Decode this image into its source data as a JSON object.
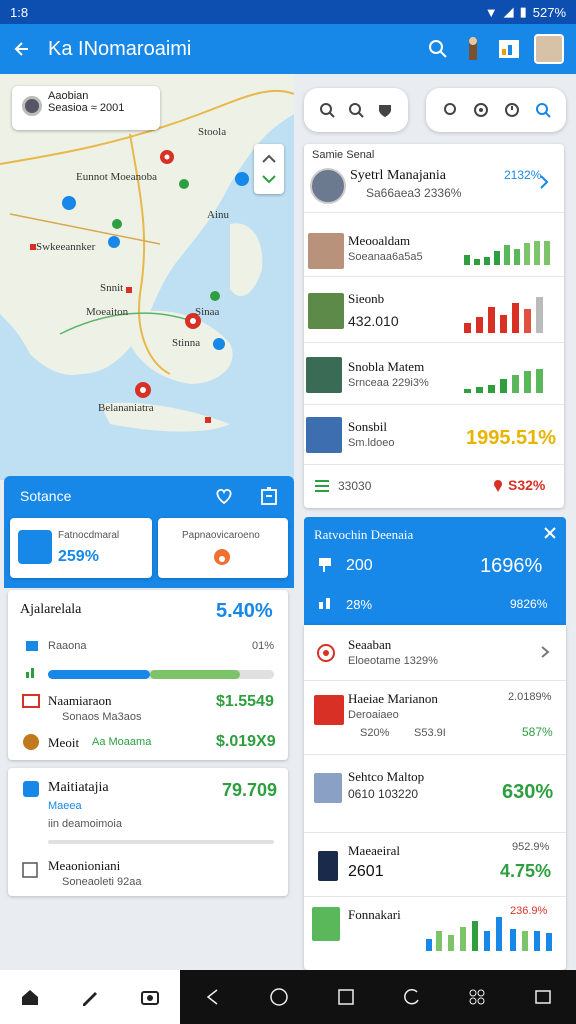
{
  "status": {
    "time": "1:8",
    "battery": "527%"
  },
  "appbar": {
    "title": "Ka INomaroaimi"
  },
  "map": {
    "info_line1": "Aaobian",
    "info_line2": "Seasioa ≈ 2001",
    "labels": [
      "Stoola",
      "Eunnot Moeanoba",
      "Ainu",
      "Swkeeannker",
      "Snnit",
      "Moeaiton",
      "Sinaa",
      "Stinna",
      "Belananiatra"
    ]
  },
  "right_list": {
    "header": "Samie Senal",
    "rows": [
      {
        "title": "Syetrl Manajania",
        "sub": "Sa66aea3 2336%",
        "value": "2132%"
      },
      {
        "title": "Meooaldam",
        "sub": "Soeanaa6a5a5"
      },
      {
        "title": "Sieonb",
        "sub": "432.010"
      },
      {
        "title": "Snobla Matem",
        "sub": "Srnceaa 229i3%"
      },
      {
        "title": "Sonsbil",
        "sub": "Sm.ldoeo",
        "value": "1995.51%"
      }
    ],
    "footer_left": "33030",
    "footer_right": "S32%"
  },
  "left_panel": {
    "title": "Sotance",
    "box1_label": "Fatnocdmaral",
    "box1_value": "259%",
    "box2_label": "Papnaovicaroeno"
  },
  "card_a": {
    "title": "Ajalarelala",
    "value": "5.40%",
    "row1_label": "Raaona",
    "row1_value": "01%",
    "bar1_fraction": 0.45,
    "bar2_fraction": 0.4,
    "row2_label": "Naamiaraon",
    "row2_sub": "Sonaos Ma3aos",
    "row2_value": "$1.5549",
    "row3_label": "Meoit",
    "row3_sub": "Aa Moaama",
    "row3_value": "$.019X9"
  },
  "card_b": {
    "title": "Maitiatajia",
    "value": "79.709",
    "sub1": "Maeea",
    "sub2": "iin deamoimoia",
    "row_label": "Meaonioniani",
    "row_sub": "Soneaoleti 92aa"
  },
  "blue_card": {
    "title": "Ratvochin Deenaia",
    "row1_left": "200",
    "row1_right": "1696%",
    "row2_left": "28%",
    "row2_right": "9826%"
  },
  "detail_list": [
    {
      "title": "Seaaban",
      "sub": "Eloeotame 1329%"
    },
    {
      "title": "Haeiae Marianon",
      "sub": "Deroaiaeo",
      "sub2": "S20%",
      "sub3": "S53.9I",
      "value": "2.0189%",
      "value2": "587%"
    },
    {
      "title": "Sehtco Maltop",
      "sub": "0610 103220",
      "value": "630%"
    },
    {
      "title": "Maeaeiral",
      "sub": "2601",
      "value": "952.9%",
      "value2": "4.75%"
    },
    {
      "title": "Fonnakari",
      "value": "236.9%"
    }
  ],
  "colors": {
    "brand": "#1787e8",
    "positive": "#2e9e3f",
    "negative": "#d93025",
    "highlight": "#e8b400"
  }
}
